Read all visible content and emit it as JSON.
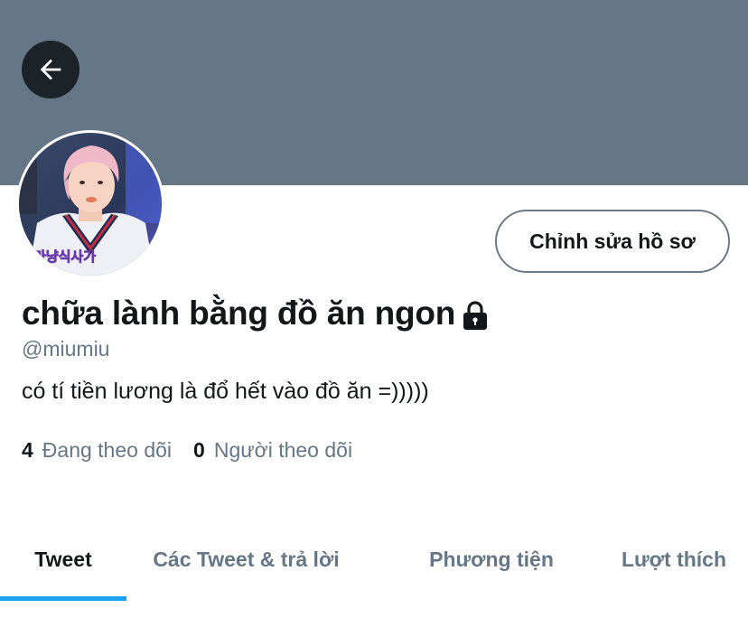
{
  "profile": {
    "display_name": "chữa lành bằng đồ ăn ngon",
    "handle": "@miumiu",
    "bio": "có tí tiền lương là đổ hết vào đồ ăn =)))))",
    "avatar_caption": "마냥식사가",
    "protected_icon": "lock-icon",
    "edit_button_label": "Chỉnh sửa hồ sơ"
  },
  "stats": {
    "following_count": "4",
    "following_label": "Đang theo dõi",
    "followers_count": "0",
    "followers_label": "Người theo dõi"
  },
  "tabs": [
    {
      "label": "Tweet",
      "active": true
    },
    {
      "label": "Các Tweet & trả lời",
      "active": false
    },
    {
      "label": "Phương tiện",
      "active": false
    },
    {
      "label": "Lượt thích",
      "active": false
    }
  ],
  "colors": {
    "banner": "#657786",
    "accent": "#1da1f2",
    "text_primary": "#14171a",
    "text_secondary": "#657786"
  }
}
